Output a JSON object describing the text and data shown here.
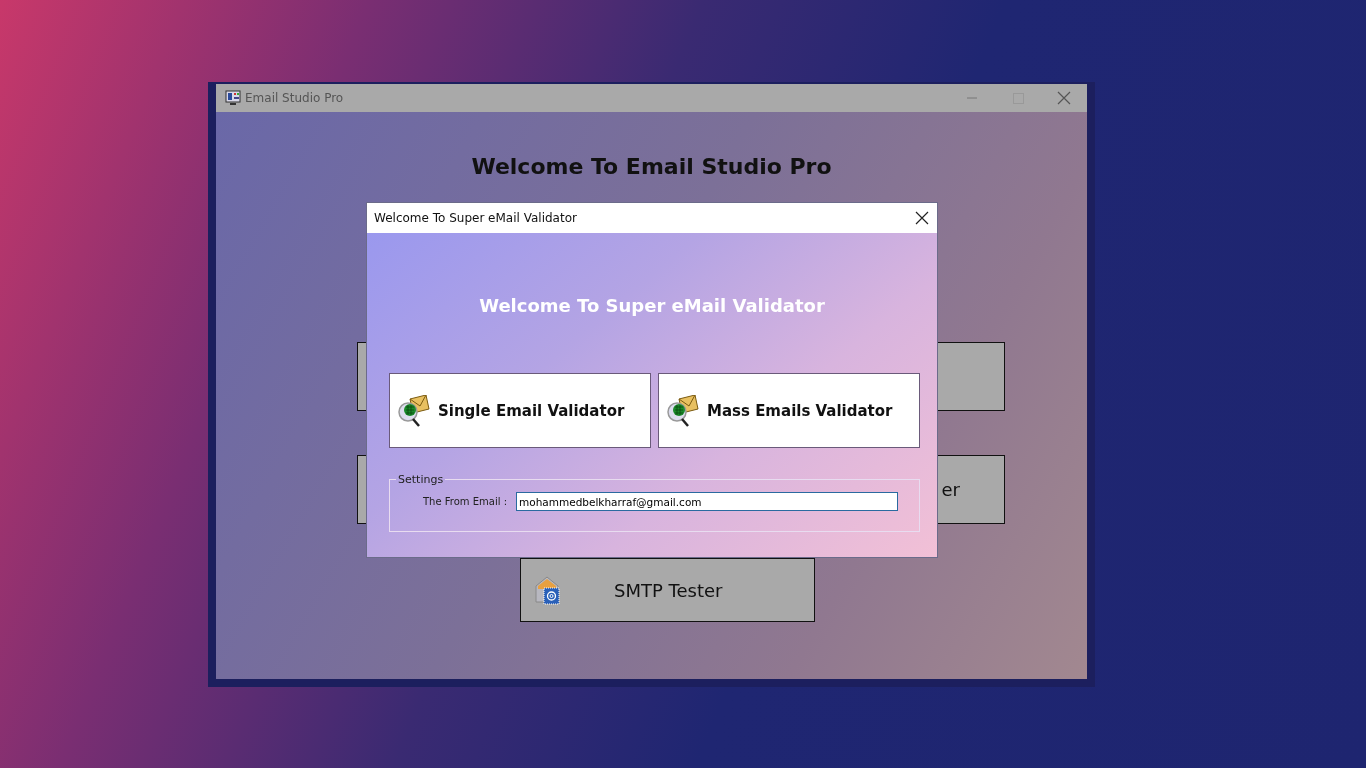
{
  "main_window": {
    "title": "Email Studio Pro",
    "heading": "Welcome To Email Studio Pro",
    "tool_buttons": [
      {
        "kind": "covered"
      },
      {
        "kind": "covered"
      },
      {
        "kind": "covered"
      },
      {
        "kind": "covered_label",
        "label": "er"
      },
      {
        "kind": "full",
        "label": "SMTP Tester"
      }
    ]
  },
  "dialog": {
    "title": "Welcome To Super eMail Validator",
    "heading": "Welcome To Super eMail Validator",
    "buttons": [
      {
        "label": "Single Email Validator"
      },
      {
        "label": "Mass Emails Validator"
      }
    ],
    "settings": {
      "legend": "Settings",
      "from_email": {
        "label": "The From Email :",
        "value": "mohammedbelkharraf@gmail.com"
      }
    }
  }
}
